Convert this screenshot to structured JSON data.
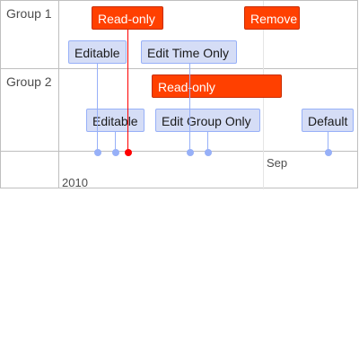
{
  "groups": [
    {
      "label": "Group 1"
    },
    {
      "label": "Group 2"
    }
  ],
  "items": {
    "g1_readonly": "Read-only",
    "g1_remove": "Remove",
    "g1_editable": "Editable",
    "g1_edit_time_only": "Edit Time Only",
    "g2_readonly": "Read-only",
    "g2_editable": "Editable",
    "g2_edit_group_only": "Edit Group Only",
    "g2_default": "Default"
  },
  "axis": {
    "minor_label": "Sep",
    "major_label": "2010"
  },
  "colors": {
    "readonly_bg": "#ff4000",
    "editable_bg": "#d5ddf6",
    "editable_border": "#97b0f8",
    "current_time_line": "#ff0000"
  }
}
